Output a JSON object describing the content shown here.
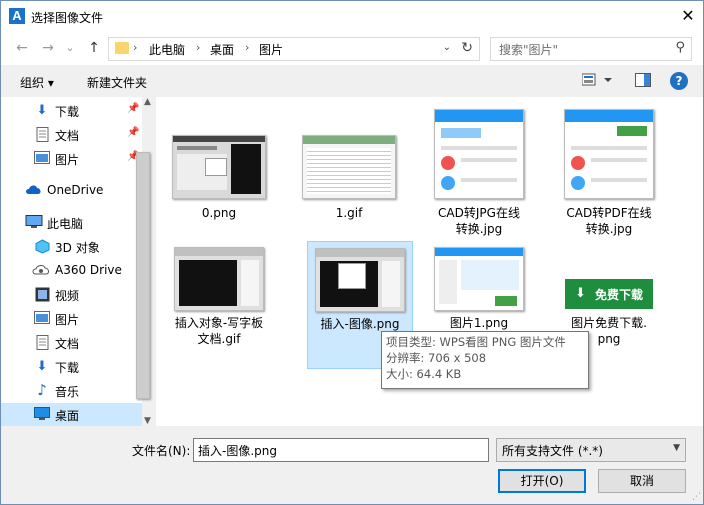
{
  "window": {
    "title": "选择图像文件",
    "close_glyph": "✕"
  },
  "nav": {
    "back": "←",
    "forward": "→",
    "dropdown": "⌄",
    "up": "↑",
    "breadcrumb": [
      "此电脑",
      "桌面",
      "图片"
    ],
    "search_placeholder": "搜索\"图片\""
  },
  "toolbar": {
    "organize": "组织 ▾",
    "new_folder": "新建文件夹",
    "help": "?"
  },
  "sidebar": {
    "items": [
      {
        "label": "下载",
        "icon": "download-icon",
        "pinned": true
      },
      {
        "label": "文档",
        "icon": "document-icon",
        "pinned": true
      },
      {
        "label": "图片",
        "icon": "picture-icon",
        "pinned": true
      },
      {
        "label": "OneDrive",
        "icon": "cloud-icon",
        "pinned": false
      },
      {
        "label": "此电脑",
        "icon": "computer-icon",
        "pinned": false
      },
      {
        "label": "3D 对象",
        "icon": "cube-icon",
        "pinned": false
      },
      {
        "label": "A360 Drive",
        "icon": "drive-icon",
        "pinned": false
      },
      {
        "label": "视频",
        "icon": "video-icon",
        "pinned": false
      },
      {
        "label": "图片",
        "icon": "picture-icon",
        "pinned": false
      },
      {
        "label": "文档",
        "icon": "document-icon",
        "pinned": false
      },
      {
        "label": "下载",
        "icon": "download-icon",
        "pinned": false
      },
      {
        "label": "音乐",
        "icon": "music-icon",
        "pinned": false
      },
      {
        "label": "桌面",
        "icon": "desktop-icon",
        "pinned": false,
        "selected": true
      }
    ]
  },
  "files": [
    {
      "name": "0.png"
    },
    {
      "name": "1.gif"
    },
    {
      "name": "CAD转JPG在线转换.jpg",
      "line1": "CAD转JPG在线",
      "line2": "转换.jpg"
    },
    {
      "name": "CAD转PDF在线转换.jpg",
      "line1": "CAD转PDF在线",
      "line2": "转换.jpg"
    },
    {
      "name": "插入对象-写字板文档.gif",
      "line1": "插入对象-写字板",
      "line2": "文档.gif"
    },
    {
      "name": "插入-图像.png",
      "selected": true
    },
    {
      "name": "图片1.png"
    },
    {
      "name": "图片免费下载.png",
      "line1": "图片免费下载.",
      "line2": "png",
      "thumb_text": "免费下载"
    }
  ],
  "tooltip": {
    "type": "项目类型: WPS看图 PNG 图片文件",
    "resolution": "分辨率: 706 x 508",
    "size": "大小: 64.4 KB"
  },
  "footer": {
    "filename_label": "文件名(N):",
    "filename_value": "插入-图像.png",
    "filetype_value": "所有支持文件 (*.*)",
    "open_button": "打开(O)",
    "cancel_button": "取消"
  },
  "colors": {
    "selection": "#cce8ff",
    "accent": "#0078d7",
    "download_green": "#1e8e3e"
  }
}
